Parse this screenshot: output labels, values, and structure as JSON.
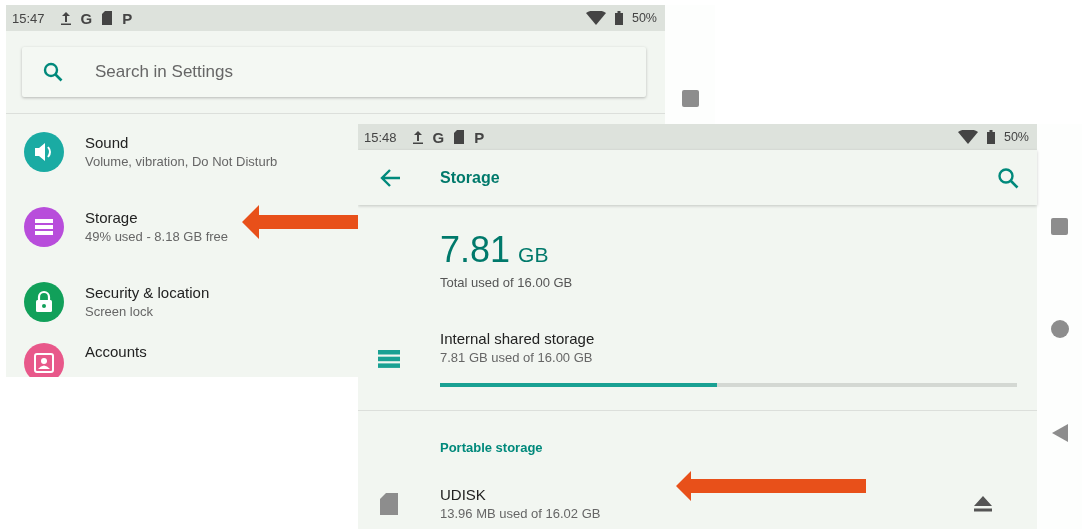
{
  "settings_screen": {
    "status_bar": {
      "time": "15:47",
      "notification_icons": [
        {
          "kind": "upload"
        },
        {
          "kind": "glyph",
          "text": "G"
        },
        {
          "kind": "sdcard"
        },
        {
          "kind": "glyph",
          "text": "P"
        }
      ],
      "battery": "50%"
    },
    "search": {
      "placeholder": "Search in Settings"
    },
    "items": [
      {
        "title": "Sound",
        "subtitle": "Volume, vibration, Do Not Disturb",
        "kind": "sound",
        "color": "#1aaba3"
      },
      {
        "title": "Storage",
        "subtitle": "49% used - 8.18 GB free",
        "kind": "storage",
        "color": "#b84ddb"
      },
      {
        "title": "Security & location",
        "subtitle": "Screen lock",
        "kind": "lock",
        "color": "#11a05a"
      },
      {
        "title": "Accounts",
        "kind": "account",
        "color": "#e8588a"
      }
    ]
  },
  "storage_screen": {
    "status_bar": {
      "time": "15:48",
      "notification_icons": [
        {
          "kind": "upload"
        },
        {
          "kind": "glyph",
          "text": "G"
        },
        {
          "kind": "sdcard"
        },
        {
          "kind": "glyph",
          "text": "P"
        }
      ],
      "battery": "50%"
    },
    "title": "Storage",
    "total": {
      "value": "7.81",
      "unit": "GB",
      "caption": "Total used of 16.00 GB"
    },
    "internal": {
      "title": "Internal shared storage",
      "subtitle": "7.81 GB used of 16.00 GB",
      "level": 0.48
    },
    "portable_header": "Portable storage",
    "portable": {
      "title": "UDISK",
      "subtitle": "13.96 MB used of 16.02 GB"
    }
  }
}
